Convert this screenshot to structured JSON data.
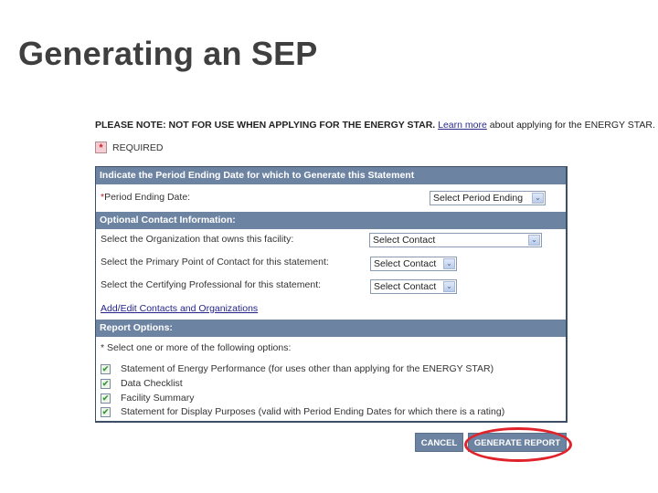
{
  "slide": {
    "title": "Generating an SEP"
  },
  "notice": {
    "bold_text": "PLEASE NOTE: NOT FOR USE WHEN APPLYING FOR THE ENERGY STAR.",
    "link_text": "Learn more",
    "trailing_text": " about applying for the ENERGY STAR."
  },
  "required": {
    "icon": "required-asterisk-icon",
    "symbol": "*",
    "label": "REQUIRED"
  },
  "sections": {
    "period": {
      "header": "Indicate the Period Ending Date for which to Generate this Statement",
      "star": "*",
      "label": "Period Ending Date:",
      "select_value": "Select Period Ending"
    },
    "contact": {
      "header": "Optional Contact Information:",
      "rows": [
        {
          "label": "Select the Organization that owns this facility:",
          "select_value": "Select Contact"
        },
        {
          "label": "Select the Primary Point of Contact for this statement:",
          "select_value": "Select Contact"
        },
        {
          "label": "Select the Certifying Professional for this statement:",
          "select_value": "Select Contact"
        }
      ],
      "link": "Add/Edit Contacts and Organizations"
    },
    "report": {
      "header": "Report Options:",
      "instruction": "* Select one or more of the following options:",
      "options": [
        {
          "label": "Statement of Energy Performance (for uses other than applying for the ENERGY STAR)",
          "checked": true
        },
        {
          "label": "Data Checklist",
          "checked": true
        },
        {
          "label": "Facility Summary",
          "checked": true
        },
        {
          "label": "Statement for Display Purposes (valid with Period Ending Dates for which there is a rating)",
          "checked": true
        }
      ]
    }
  },
  "icons": {
    "dropdown_arrow": "⌄",
    "check": "✔"
  },
  "buttons": {
    "cancel": "CANCEL",
    "generate": "GENERATE REPORT"
  },
  "colors": {
    "header_bg": "#6d83a2",
    "highlight": "#e0232b",
    "required": "#c4162a"
  }
}
